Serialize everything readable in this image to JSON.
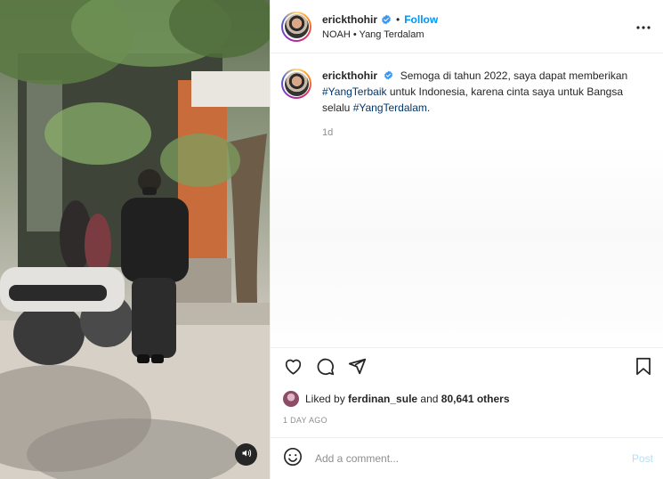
{
  "post": {
    "author": {
      "username": "erickthohir",
      "verified": true,
      "follow_label": "Follow",
      "audio": "NOAH • Yang Terdalam"
    },
    "caption": {
      "username": "erickthohir",
      "text_1": "Semoga di tahun 2022, saya dapat memberikan",
      "hashtag_1": "#YangTerbaik",
      "text_2": "untuk Indonesia, karena cinta saya untuk Bangsa selalu",
      "hashtag_2": "#YangTerdalam",
      "text_3": ".",
      "time": "1d"
    },
    "likes": {
      "prefix": "Liked by",
      "user": "ferdinan_sule",
      "middle": "and",
      "count": "80,641 others"
    },
    "date": "1 DAY AGO",
    "comment": {
      "placeholder": "Add a comment...",
      "post_label": "Post"
    }
  },
  "icons": {
    "verified": "verified-badge-icon",
    "more": "more-options-icon",
    "like": "heart-icon",
    "comment": "comment-icon",
    "share": "paper-plane-icon",
    "save": "bookmark-icon",
    "emoji": "smiley-icon",
    "sound": "speaker-icon"
  },
  "colors": {
    "accent": "#0095f6",
    "hashtag": "#00376b",
    "muted": "#8e8e8e",
    "post_disabled": "#b2dffc"
  }
}
